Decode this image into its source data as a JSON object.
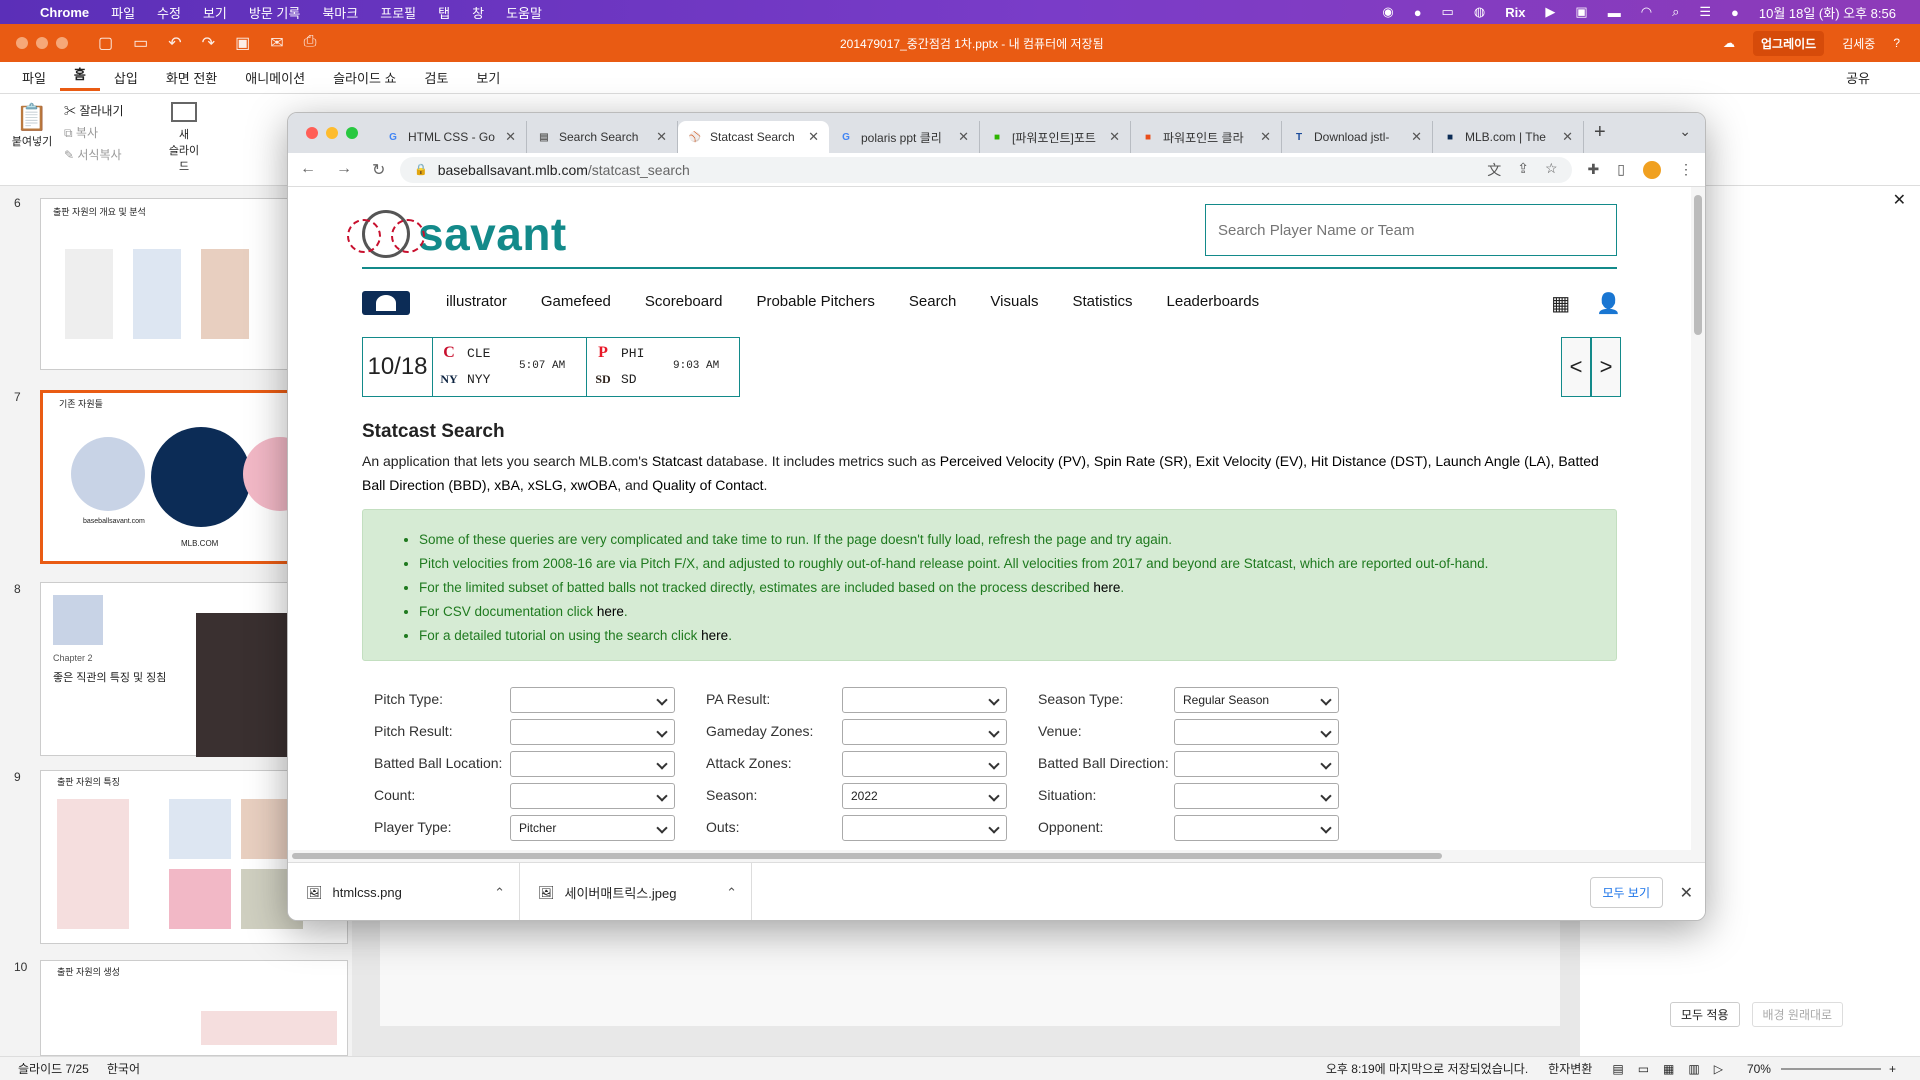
{
  "mac_menu": {
    "apple": "",
    "app": "Chrome",
    "items": [
      "파일",
      "수정",
      "보기",
      "방문 기록",
      "북마크",
      "프로필",
      "탭",
      "창",
      "도움말"
    ],
    "clock": "10월 18일 (화) 오후 8:56",
    "rix": "Rix"
  },
  "ppt": {
    "title": "201479017_중간점검 1차.pptx - 내 컴퓨터에 저장됨",
    "upgrade": "업그레이드",
    "user": "김세중",
    "tabs": [
      "파일",
      "홈",
      "삽입",
      "화면 전환",
      "애니메이션",
      "슬라이드 쇼",
      "검토",
      "보기"
    ],
    "share": "공유",
    "ribbon": {
      "paste": "붙여넣기",
      "cut": "잘라내기",
      "copy": "복사",
      "format": "서식복사",
      "new_slide": "새\n슬라이드"
    },
    "slides": [
      {
        "num": "6",
        "title": "출판 자원의 개요 및 분석"
      },
      {
        "num": "7",
        "title": "기존 자원들",
        "caption1": "baseballsavant.com",
        "caption2": "MLB.COM"
      },
      {
        "num": "8",
        "chapter": "Chapter 2",
        "title": "좋은 직관의 특징 및 징침"
      },
      {
        "num": "9",
        "title": "출판 자원의 특징"
      },
      {
        "num": "10",
        "title": "출판 자원의 생성"
      }
    ],
    "apply_all": "모두 적용",
    "reset_bg": "배경 원래대로",
    "status": {
      "slide": "슬라이드 7/25",
      "lang": "한국어",
      "saved": "오후 8:19에 마지막으로 저장되었습니다.",
      "convert": "한자변환",
      "zoom": "70%"
    }
  },
  "chrome": {
    "tabs": [
      {
        "label": "HTML CSS - Go",
        "icon": "G",
        "color": "#4285f4"
      },
      {
        "label": "Search Search",
        "icon": "▤",
        "color": "#666"
      },
      {
        "label": "Statcast Search",
        "icon": "⚾",
        "color": "#138a8a",
        "active": true
      },
      {
        "label": "polaris ppt 클리",
        "icon": "G",
        "color": "#4285f4"
      },
      {
        "label": "[파워포인트]포트",
        "icon": "■",
        "color": "#2db400"
      },
      {
        "label": "파워포인트 클라",
        "icon": "■",
        "color": "#e94e1b"
      },
      {
        "label": "Download jstl-",
        "icon": "T",
        "color": "#1a4a9a"
      },
      {
        "label": "MLB.com | The",
        "icon": "■",
        "color": "#0c2c56"
      }
    ],
    "url_host": "baseballsavant.mlb.com",
    "url_path": "/statcast_search",
    "downloads": [
      {
        "name": "htmlcss.png"
      },
      {
        "name": "세이버매트릭스.jpeg"
      }
    ],
    "show_all": "모두 보기"
  },
  "savant": {
    "brand": "savant",
    "search_placeholder": "Search Player Name or Team",
    "nav": [
      "illustrator",
      "Gamefeed",
      "Scoreboard",
      "Probable Pitchers",
      "Search",
      "Visuals",
      "Statistics",
      "Leaderboards"
    ],
    "date": "10/18",
    "games": [
      {
        "away": "CLE",
        "home": "NYY",
        "time": "5:07 AM",
        "away_logo": "C",
        "home_logo": "NY",
        "away_color": "#c8102e",
        "home_color": "#0c2340"
      },
      {
        "away": "PHI",
        "home": "SD",
        "time": "9:03 AM",
        "away_logo": "P",
        "home_logo": "SD",
        "away_color": "#e81828",
        "home_color": "#2f241d"
      }
    ],
    "prev": "<",
    "next": ">",
    "heading": "Statcast Search",
    "desc_parts": [
      "An application that lets you search MLB.com's ",
      "Statcast",
      " database. It includes metrics such as ",
      "Perceived Velocity (PV), Spin Rate (SR), Exit Velocity (EV), Hit Distance (DST), Launch Angle (LA), Batted Ball Direction (BBD), xBA, xSLG, xwOBA",
      ", and ",
      "Quality of Contact",
      "."
    ],
    "notes": [
      {
        "text": "Some of these queries are very complicated and take time to run. If the page doesn't fully load, refresh the page and try again."
      },
      {
        "text": "Pitch velocities from 2008-16 are via Pitch F/X, and adjusted to roughly out-of-hand release point. All velocities from 2017 and beyond are Statcast, which are reported out-of-hand."
      },
      {
        "text": "For the limited subset of batted balls not tracked directly, estimates are included based on the process described ",
        "link": "here",
        "end": "."
      },
      {
        "text": "For CSV documentation click ",
        "link": "here",
        "end": "."
      },
      {
        "text": "For a detailed tutorial on using the search click ",
        "link": "here",
        "end": "."
      }
    ],
    "filters": [
      [
        {
          "label": "Pitch Type:",
          "value": ""
        },
        {
          "label": "PA Result:",
          "value": ""
        },
        {
          "label": "Season Type:",
          "value": "Regular Season"
        }
      ],
      [
        {
          "label": "Pitch Result:",
          "value": ""
        },
        {
          "label": "Gameday Zones:",
          "value": ""
        },
        {
          "label": "Venue:",
          "value": ""
        }
      ],
      [
        {
          "label": "Batted Ball Location:",
          "value": ""
        },
        {
          "label": "Attack Zones:",
          "value": ""
        },
        {
          "label": "Batted Ball Direction:",
          "value": ""
        }
      ],
      [
        {
          "label": "Count:",
          "value": ""
        },
        {
          "label": "Season:",
          "value": "2022"
        },
        {
          "label": "Situation:",
          "value": ""
        }
      ],
      [
        {
          "label": "Player Type:",
          "value": "Pitcher"
        },
        {
          "label": "Outs:",
          "value": ""
        },
        {
          "label": "Opponent:",
          "value": ""
        }
      ]
    ]
  }
}
